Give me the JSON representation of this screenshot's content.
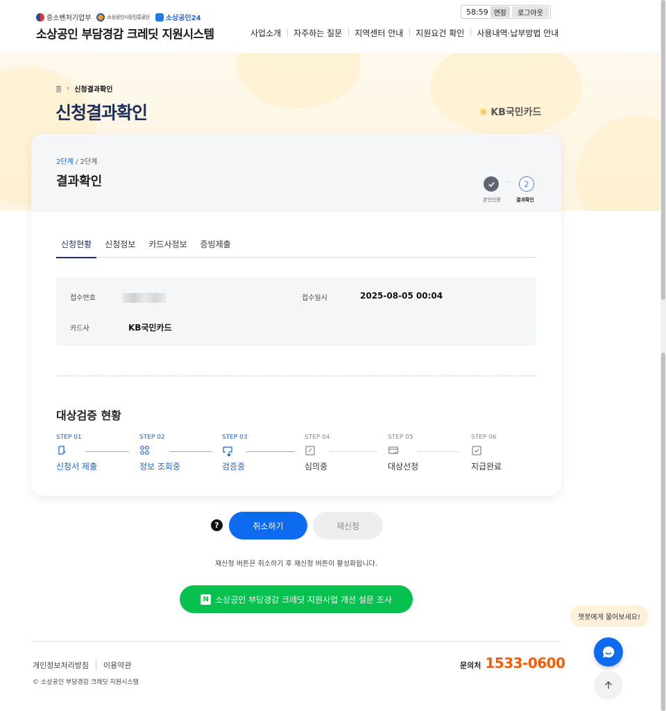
{
  "header": {
    "logos": [
      "중소벤처기업부",
      "소상공인시장진흥공단",
      "소상공인24"
    ],
    "site_title": "소상공인 부담경감 크레딧 지원시스템",
    "timer": "58:59",
    "extend_label": "연장",
    "logout_label": "로그아웃",
    "nav": [
      "사업소개",
      "자주하는 질문",
      "지역센터 안내",
      "지원요건 확인",
      "사용내역·납부방법 안내"
    ]
  },
  "breadcrumb": {
    "home": "홈",
    "current": "신청결과확인"
  },
  "page_title": "신청결과확인",
  "card_brand": "KB국민카드",
  "card": {
    "step_current": "2단계",
    "step_total": "/ 2단계",
    "title": "결과확인",
    "mini_steps": [
      {
        "label": "본인인증",
        "state": "done"
      },
      {
        "label": "결과확인",
        "number": "2",
        "state": "current"
      }
    ],
    "tabs": [
      "신청현황",
      "신청정보",
      "카드사정보",
      "증빙제출"
    ],
    "active_tab": "신청현황",
    "info": {
      "receipt_no_label": "접수번호",
      "receipt_date_label": "접수일시",
      "receipt_date": "2025-08-05 00:04",
      "card_company_label": "카드사",
      "card_company": "KB국민카드"
    },
    "verification_title": "대상검증 현황",
    "steps": [
      {
        "no": "STEP 01",
        "name": "신청서 제출",
        "active": true,
        "icon": "document-pen-icon"
      },
      {
        "no": "STEP 02",
        "name": "정보 조회중",
        "active": true,
        "icon": "search-grid-icon"
      },
      {
        "no": "STEP 03",
        "name": "검증중",
        "active": true,
        "icon": "verify-star-icon"
      },
      {
        "no": "STEP 04",
        "name": "심의중",
        "active": false,
        "icon": "edit-square-icon"
      },
      {
        "no": "STEP 05",
        "name": "대상선정",
        "active": false,
        "icon": "card-check-icon"
      },
      {
        "no": "STEP 06",
        "name": "지급완료",
        "active": false,
        "icon": "checkbox-icon"
      }
    ]
  },
  "actions": {
    "help": "?",
    "cancel": "취소하기",
    "reapply": "재신청",
    "notice": "재신청 버튼은 취소하기 후 재신청 버튼이 활성화됩니다.",
    "survey_badge": "N",
    "survey": "소상공인 부담경감 크레딧 지원사업 개선 설문 조사"
  },
  "footer": {
    "links": [
      "개인정보처리방침",
      "이용약관"
    ],
    "copyright": "© 소상공인 부담경감 크레딧 지원시스템",
    "contact_label": "문의처",
    "contact_number": "1533-0600"
  },
  "floating": {
    "chat_bubble": "챗봇에게 물어보세요!"
  },
  "colors": {
    "primary": "#0d6bf0",
    "navy": "#1b2e5a",
    "survey": "#06c14d",
    "contact": "#ff5a00"
  }
}
